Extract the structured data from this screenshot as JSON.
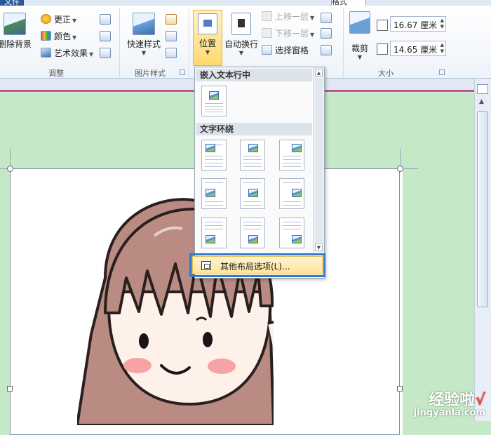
{
  "tabs": [
    {
      "label": "文件"
    },
    {
      "label": "格式"
    }
  ],
  "ribbon": {
    "adjust": {
      "remove_bg": "删除背景",
      "corrections": "更正",
      "color": "颜色",
      "artistic": "艺术效果",
      "group_label": "调整"
    },
    "styles": {
      "quick_styles": "快速样式",
      "group_label": "图片样式"
    },
    "arrange": {
      "position": "位置",
      "wrap_text": "自动换行",
      "bring_forward": "上移一层",
      "send_backward": "下移一层",
      "selection_pane": "选择窗格"
    },
    "size": {
      "crop": "裁剪",
      "height": "16.67 厘米",
      "width": "14.65 厘米",
      "group_label": "大小"
    }
  },
  "position_menu": {
    "inline_header": "嵌入文本行中",
    "wrap_header": "文字环绕",
    "more_options": "其他布局选项(L)..."
  },
  "watermark": {
    "brand": "经验啦",
    "check": "√",
    "url": "jingyanla.com"
  },
  "colors": {
    "doc_background": "#c5e8c7",
    "highlight_border": "#2f7bd3",
    "hover_fill": "#ffe395"
  },
  "icons": [
    "remove-background-icon",
    "corrections-icon",
    "color-icon",
    "artistic-effects-icon",
    "quick-styles-icon",
    "position-icon",
    "wrap-text-icon",
    "crop-icon",
    "layout-options-icon"
  ]
}
